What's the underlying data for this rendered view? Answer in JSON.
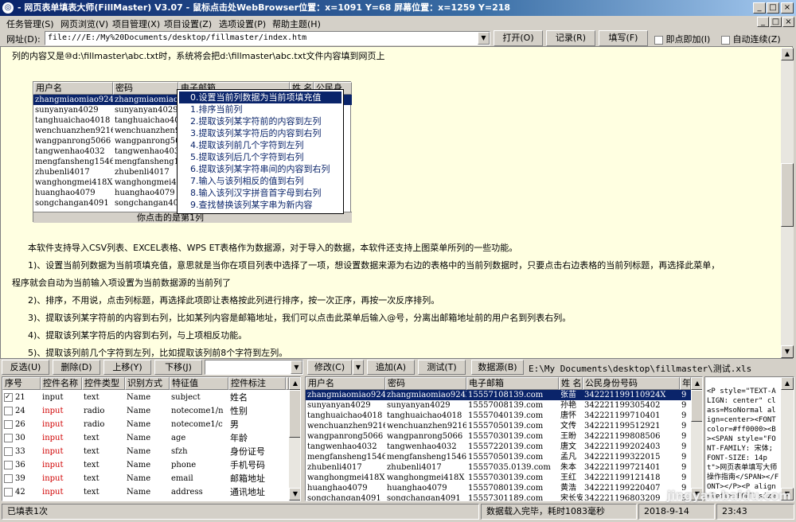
{
  "title": "- 网页表单填表大师(FillMaster) V3.07 - 鼠标点击处WebBrowser位置：x=1091 Y=68 屏幕位置：x=1259 Y=218",
  "menu": [
    "任务管理(S)",
    "网页浏览(V)",
    "项目管理(X)",
    "项目设置(Z)",
    "选项设置(P)",
    "帮助主题(H)"
  ],
  "address": {
    "label": "网址(D):",
    "value": "file:///E:/My%20Documents/desktop/fillmaster/index.htm"
  },
  "toolbar": {
    "open": "打开(O)",
    "record": "记录(R)",
    "fill": "填写(F)",
    "instant": "即点即加(I)",
    "auto": "自动连续(Z)"
  },
  "doc": {
    "line1": "列的内容又是⑩d:\\fillmaster\\abc.txt时，系统将会把d:\\fillmaster\\abc.txt文件内容填到网页上",
    "p0": "本软件支持导入CSV列表、EXCEL表格、WPS ET表格作为数据源，对于导入的数据，本软件还支持上图菜单所列的一些功能。",
    "p1a": "1)、设置当前列数据为当前项填充值，意思就是当你在项目列表中选择了一项，想设置数据来源为右边的表格中的当前列数据时，只要点击右边表格的当前列标题，再选择此菜单，",
    "p1b": "程序就会自动为当前输入项设置为当前数据源的当前列了",
    "p2": "2)、排序，不用说，点击列标题，再选择此项即让表格按此列进行排序，按一次正序，再按一次反序排列。",
    "p3": "3)、提取该列某字符前的内容到右列，比如某列内容是邮箱地址，我们可以点击此菜单后输入@号，分离出邮箱地址前的用户名到列表右列。",
    "p4": "4)、提取该列某字符后的内容到右列，与上项相反功能。",
    "p5": "5)、提取该列前几个字符到左列，比如提取该列前8个字符到左列。"
  },
  "embed": {
    "headers": [
      "用户名",
      "密码",
      "电子邮箱",
      "姓 名",
      "公民身"
    ],
    "rows": [
      [
        "zhangmiaomiao924X",
        "zhangmiaomiao9"
      ],
      [
        "sunyanyan4029",
        "sunyanyan4029"
      ],
      [
        "tanghuaichao4018",
        "tanghuaichao40"
      ],
      [
        "wenchuanzhen9216",
        "wenchuanzhen92"
      ],
      [
        "wangpanrong5066",
        "wangpanrong506"
      ],
      [
        "tangwenhao4032",
        "tangwenhao4032"
      ],
      [
        "mengfansheng1546",
        "mengfansheng15"
      ],
      [
        "zhubenli4017",
        "zhubenli4017"
      ],
      [
        "wanghongmei418X",
        "wanghongmei418"
      ],
      [
        "huanghao4079",
        "huanghao4079"
      ],
      [
        "songchangan4091",
        "songchangan409"
      ]
    ],
    "status": "你点击的是第1列"
  },
  "context_menu": [
    "0.设置当前列数据为当前项填充值",
    "1.排序当前列",
    "2.提取该列某字符前的内容到左列",
    "3.提取该列某字符后的内容到右列",
    "4.提取该列前几个字符到左列",
    "5.提取该列后几个字符到右列",
    "6.提取该列某字符串间的内容到右列",
    "7.输入与该列相反的值到右列",
    "8.输入该列汉字拼音首字母到右列",
    "9.查找替换该列某字串为新内容"
  ],
  "buttons": {
    "invert": "反选(U)",
    "delete": "删除(D)",
    "up": "上移(Y)",
    "down": "下移(J)",
    "modify": "修改(C)",
    "add": "追加(A)",
    "test": "测试(T)",
    "datasource": "数据源(B)"
  },
  "datasource_path": "E:\\My Documents\\desktop\\fillmaster\\测试.xls",
  "left_grid": {
    "headers": [
      "序号",
      "控件名称",
      "控件类型",
      "识别方式",
      "特征值",
      "控件标注",
      "",
      ""
    ],
    "rows": [
      {
        "id": "21",
        "name": "input",
        "type": "text",
        "by": "Name",
        "val": "subject",
        "label": "姓名",
        "checked": true,
        "red": false
      },
      {
        "id": "24",
        "name": "input",
        "type": "radio",
        "by": "Name",
        "val": "notecome1/n",
        "label": "性别",
        "checked": false,
        "red": true
      },
      {
        "id": "26",
        "name": "input",
        "type": "radio",
        "by": "Name",
        "val": "notecome1/c",
        "label": "男",
        "checked": false,
        "red": true
      },
      {
        "id": "30",
        "name": "input",
        "type": "text",
        "by": "Name",
        "val": "age",
        "label": "年龄",
        "checked": false,
        "red": true
      },
      {
        "id": "33",
        "name": "input",
        "type": "text",
        "by": "Name",
        "val": "sfzh",
        "label": "身份证号",
        "checked": false,
        "red": true
      },
      {
        "id": "36",
        "name": "input",
        "type": "text",
        "by": "Name",
        "val": "phone",
        "label": "手机号码",
        "checked": false,
        "red": true
      },
      {
        "id": "39",
        "name": "input",
        "type": "text",
        "by": "Name",
        "val": "email",
        "label": "邮箱地址",
        "checked": false,
        "red": true
      },
      {
        "id": "42",
        "name": "input",
        "type": "text",
        "by": "Name",
        "val": "address",
        "label": "通讯地址",
        "checked": false,
        "red": true
      }
    ]
  },
  "right_grid": {
    "headers": [
      "用户名",
      "密码",
      "电子邮箱",
      "姓 名",
      "公民身份号码",
      "年"
    ],
    "rows": [
      [
        "zhangmiaomiao924X",
        "zhangmiaomiao924X",
        "15557108139.com",
        "张苗",
        "342221199110924X",
        "9"
      ],
      [
        "sunyanyan4029",
        "sunyanyan4029",
        "15557008139.com",
        "孙艳",
        "342221199305402",
        "9"
      ],
      [
        "tanghuaichao4018",
        "tanghuaichao4018",
        "15557040139.com",
        "唐怀",
        "342221199710401",
        "9"
      ],
      [
        "wenchuanzhen9216",
        "wenchuanzhen9216",
        "15557050139.com",
        "文传",
        "342221199512921",
        "9"
      ],
      [
        "wangpanrong5066",
        "wangpanrong5066",
        "15557030139.com",
        "王盼",
        "342221199808506",
        "9"
      ],
      [
        "tangwenhao4032",
        "tangwenhao4032",
        "15557220139.com",
        "唐文",
        "342221199202403",
        "9"
      ],
      [
        "mengfansheng1546",
        "mengfansheng1546",
        "15557050139.com",
        "孟凡",
        "342221199322015",
        "9"
      ],
      [
        "zhubenli4017",
        "zhubenli4017",
        "15557035.0139.com",
        "朱本",
        "342221199721401",
        "9"
      ],
      [
        "wanghongmei418X",
        "wanghongmei418X",
        "15557030139.com",
        "王红",
        "342221199121418",
        "9"
      ],
      [
        "huanghao4079",
        "huanghao4079",
        "15557080139.com",
        "黄浩",
        "342221199220407",
        "9"
      ],
      [
        "songchangan4091",
        "songchangan4091",
        "15557301189.com",
        "宋长安",
        "342221196803209",
        "9"
      ]
    ]
  },
  "source_text": "<P style=\"TEXT-ALIGN: center\" class=MsoNormal align=center><FONT color=#ff0000><B><SPAN style=\"FONT-FAMILY: 宋体; FONT-SIZE: 14pt\">网页表单填写大师操作指南</SPAN></FONT></P><P align=left><FONT size=2>首先的用户朋",
  "status": {
    "left": "已填表1次",
    "msg": "数据载入完毕，耗时1083毫秒",
    "date": "2018-9-14",
    "time": "23:43"
  },
  "watermark": "jingyan.baidu.com"
}
